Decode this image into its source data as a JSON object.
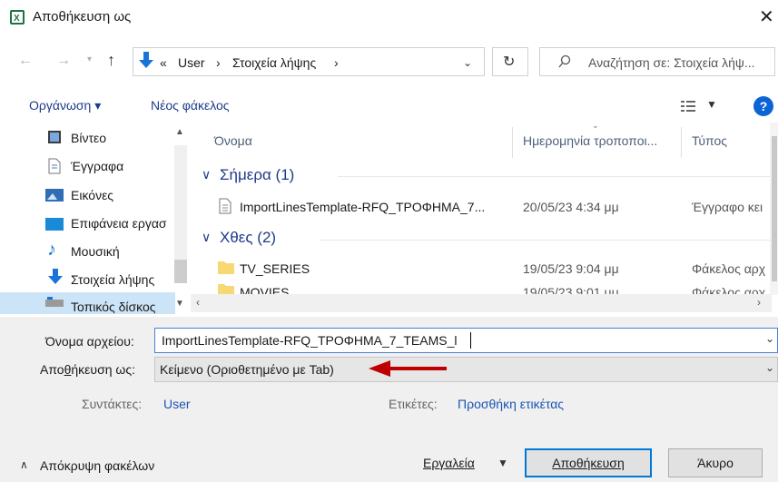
{
  "window": {
    "title": "Αποθήκευση ως",
    "close_glyph": "✕"
  },
  "address": {
    "crumbs": [
      "«",
      "User",
      "›",
      "Στοιχεία λήψης",
      "›"
    ],
    "search_placeholder": "Αναζήτηση σε: Στοιχεία λήψ..."
  },
  "toolbar": {
    "organize": "Οργάνωση ▾",
    "new_folder": "Νέος φάκελος"
  },
  "nav": {
    "items": [
      "Βίντεο",
      "Έγγραφα",
      "Εικόνες",
      "Επιφάνεια εργασ",
      "Μουσική",
      "Στοιχεία λήψης",
      "Τοπικός δίσκος"
    ]
  },
  "columns": {
    "name": "Όνομα",
    "date": "Ημερομηνία τροποποι...",
    "type": "Τύπος"
  },
  "groups": [
    {
      "label": "Σήμερα (1)",
      "rows": [
        {
          "name": "ImportLinesTemplate-RFQ_ΤΡΟΦΗΜΑ_7...",
          "date": "20/05/23 4:34 μμ",
          "type": "Έγγραφο κει"
        }
      ]
    },
    {
      "label": "Χθες (2)",
      "rows": [
        {
          "name": "TV_SERIES",
          "date": "19/05/23 9:04 μμ",
          "type": "Φάκελος αρχ"
        },
        {
          "name": "MOVIES",
          "date": "19/05/23 9:01 μμ",
          "type": "Φάκελος αρχ"
        }
      ]
    }
  ],
  "form": {
    "filename_label": "Όνομα αρχείου:",
    "filename_value": "ImportLinesTemplate-RFQ_ΤΡΟΦΗΜΑ_7_TEAMS_l",
    "savetype_label_pre": "Απο",
    "savetype_label_acc": "θ",
    "savetype_label_post": "ήκευση ως:",
    "savetype_value": "Κείμενο (Οριοθετημένο με Tab)",
    "authors_label": "Συντάκτες:",
    "authors_value": "User",
    "tags_label": "Ετικέτες:",
    "tags_value": "Προσθήκη ετικέτας"
  },
  "footer": {
    "hide_folders": "Απόκρυψη φακέλων",
    "tools": "Εργαλεία",
    "save": "Αποθήκευση",
    "cancel": "Άκυρο"
  },
  "colors": {
    "accent": "#0078d7",
    "arrow": "#c00000",
    "group": "#1e3a8a"
  }
}
